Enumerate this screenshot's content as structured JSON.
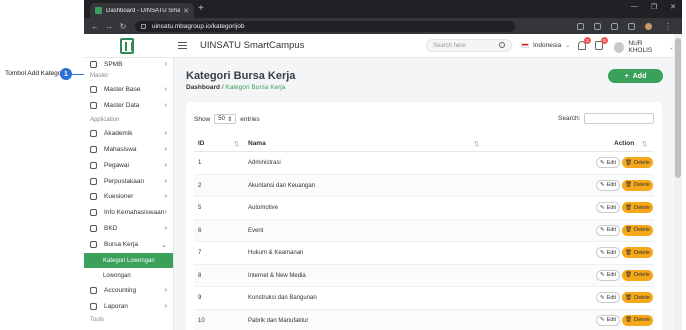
{
  "annotation": {
    "label": "Tombol Add Kategori",
    "step": "1"
  },
  "browser": {
    "tab_title": "Dashboard - UINSATU SmartCam",
    "url": "uinsatu.mbagroup.io/kategorijob"
  },
  "topbar": {
    "app_name": "UINSATU SmartCampus",
    "search_placeholder": "Search here",
    "language": "Indonesia",
    "notif_count": "1",
    "message_count": "6",
    "user_name": "NUR KHOLIS"
  },
  "sidebar": {
    "spmb": "SPMB",
    "section_master": "Master",
    "master_base": "Master Base",
    "master_data": "Master Data",
    "section_application": "Application",
    "akademik": "Akademik",
    "mahasiswa": "Mahasiswa",
    "pegawai": "Pegawai",
    "perpustakaan": "Perpustakaan",
    "kuesioner": "Kuesioner",
    "info_kemahasiswaan": "Info Kemahasiswaan",
    "bkd": "BKD",
    "bursa_kerja": "Bursa Kerja",
    "sub_kategori": "Kategori Lowongan",
    "sub_lowongan": "Lowongan",
    "accounting": "Accounting",
    "laporan": "Laporan",
    "section_tools": "Tools"
  },
  "page": {
    "title": "Kategori Bursa Kerja",
    "breadcrumb_root": "Dashboard",
    "breadcrumb_sep": "/",
    "breadcrumb_current": "Kategori Bursa Kerja",
    "add_label": "Add"
  },
  "table_controls": {
    "show_label": "Show",
    "entries_value": "50",
    "entries_label": "entries",
    "search_label": "Search:"
  },
  "table": {
    "headers": {
      "id": "ID",
      "name": "Nama",
      "action": "Action"
    },
    "edit_label": "Edit",
    "delete_label": "Delete",
    "rows": [
      {
        "id": "1",
        "name": "Administrasi"
      },
      {
        "id": "2",
        "name": "Akuntansi dan Keuangan"
      },
      {
        "id": "5",
        "name": "Automotive"
      },
      {
        "id": "6",
        "name": "Event"
      },
      {
        "id": "7",
        "name": "Hukum & Keamanan"
      },
      {
        "id": "8",
        "name": "Internet & New Media"
      },
      {
        "id": "9",
        "name": "Konstruksi dan Bangunan"
      },
      {
        "id": "10",
        "name": "Pabrik dan Manufaktur"
      }
    ]
  },
  "colors": {
    "brand_green": "#3aa05a",
    "delete_orange": "#f4a81a",
    "annotation_blue": "#2d6fd8"
  }
}
